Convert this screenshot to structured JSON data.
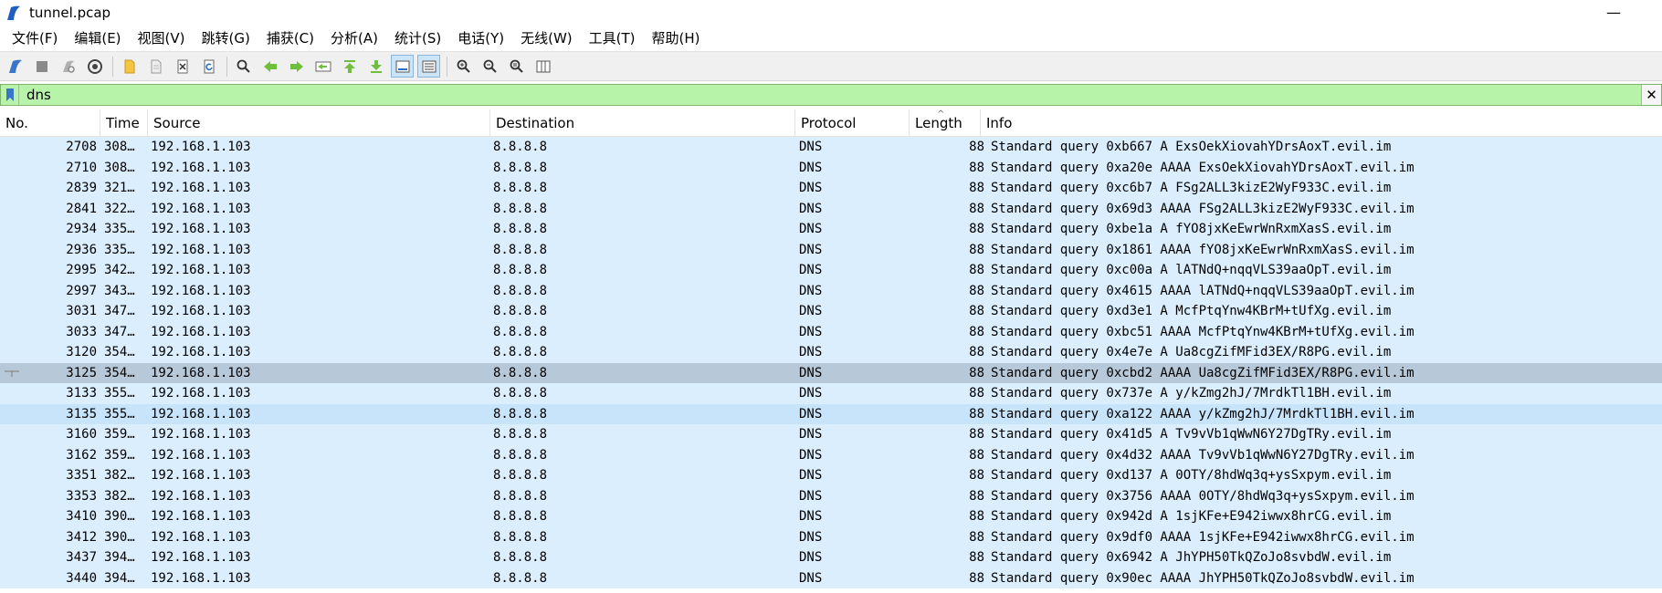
{
  "window": {
    "title": "tunnel.pcap",
    "minimize": "—"
  },
  "menu": [
    "文件(F)",
    "编辑(E)",
    "视图(V)",
    "跳转(G)",
    "捕获(C)",
    "分析(A)",
    "统计(S)",
    "电话(Y)",
    "无线(W)",
    "工具(T)",
    "帮助(H)"
  ],
  "filter": {
    "value": "dns",
    "clear": "✕"
  },
  "columns": {
    "no": "No.",
    "time": "Time",
    "source": "Source",
    "destination": "Destination",
    "protocol": "Protocol",
    "length": "Length",
    "info": "Info",
    "sort_indicator": "^"
  },
  "colors": {
    "row_bg": "#daeefe",
    "selected_bg": "#b7c8d8",
    "filter_bg": "#b7f3a8"
  },
  "packets": [
    {
      "no": "2708",
      "time": "308…",
      "src": "192.168.1.103",
      "dst": "8.8.8.8",
      "proto": "DNS",
      "len": "88",
      "info": "Standard query 0xb667 A ExsOekXiovahYDrsAoxT.evil.im"
    },
    {
      "no": "2710",
      "time": "308…",
      "src": "192.168.1.103",
      "dst": "8.8.8.8",
      "proto": "DNS",
      "len": "88",
      "info": "Standard query 0xa20e AAAA ExsOekXiovahYDrsAoxT.evil.im"
    },
    {
      "no": "2839",
      "time": "321…",
      "src": "192.168.1.103",
      "dst": "8.8.8.8",
      "proto": "DNS",
      "len": "88",
      "info": "Standard query 0xc6b7 A FSg2ALL3kizE2WyF933C.evil.im"
    },
    {
      "no": "2841",
      "time": "322…",
      "src": "192.168.1.103",
      "dst": "8.8.8.8",
      "proto": "DNS",
      "len": "88",
      "info": "Standard query 0x69d3 AAAA FSg2ALL3kizE2WyF933C.evil.im"
    },
    {
      "no": "2934",
      "time": "335…",
      "src": "192.168.1.103",
      "dst": "8.8.8.8",
      "proto": "DNS",
      "len": "88",
      "info": "Standard query 0xbe1a A fYO8jxKeEwrWnRxmXasS.evil.im"
    },
    {
      "no": "2936",
      "time": "335…",
      "src": "192.168.1.103",
      "dst": "8.8.8.8",
      "proto": "DNS",
      "len": "88",
      "info": "Standard query 0x1861 AAAA fYO8jxKeEwrWnRxmXasS.evil.im"
    },
    {
      "no": "2995",
      "time": "342…",
      "src": "192.168.1.103",
      "dst": "8.8.8.8",
      "proto": "DNS",
      "len": "88",
      "info": "Standard query 0xc00a A lATNdQ+nqqVLS39aaOpT.evil.im"
    },
    {
      "no": "2997",
      "time": "343…",
      "src": "192.168.1.103",
      "dst": "8.8.8.8",
      "proto": "DNS",
      "len": "88",
      "info": "Standard query 0x4615 AAAA lATNdQ+nqqVLS39aaOpT.evil.im"
    },
    {
      "no": "3031",
      "time": "347…",
      "src": "192.168.1.103",
      "dst": "8.8.8.8",
      "proto": "DNS",
      "len": "88",
      "info": "Standard query 0xd3e1 A McfPtqYnw4KBrM+tUfXg.evil.im"
    },
    {
      "no": "3033",
      "time": "347…",
      "src": "192.168.1.103",
      "dst": "8.8.8.8",
      "proto": "DNS",
      "len": "88",
      "info": "Standard query 0xbc51 AAAA McfPtqYnw4KBrM+tUfXg.evil.im"
    },
    {
      "no": "3120",
      "time": "354…",
      "src": "192.168.1.103",
      "dst": "8.8.8.8",
      "proto": "DNS",
      "len": "88",
      "info": "Standard query 0x4e7e A Ua8cgZifMFid3EX/R8PG.evil.im"
    },
    {
      "no": "3125",
      "time": "354…",
      "src": "192.168.1.103",
      "dst": "8.8.8.8",
      "proto": "DNS",
      "len": "88",
      "info": "Standard query 0xcbd2 AAAA Ua8cgZifMFid3EX/R8PG.evil.im"
    },
    {
      "no": "3133",
      "time": "355…",
      "src": "192.168.1.103",
      "dst": "8.8.8.8",
      "proto": "DNS",
      "len": "88",
      "info": "Standard query 0x737e A y/kZmg2hJ/7MrdkTl1BH.evil.im"
    },
    {
      "no": "3135",
      "time": "355…",
      "src": "192.168.1.103",
      "dst": "8.8.8.8",
      "proto": "DNS",
      "len": "88",
      "info": "Standard query 0xa122 AAAA y/kZmg2hJ/7MrdkTl1BH.evil.im"
    },
    {
      "no": "3160",
      "time": "359…",
      "src": "192.168.1.103",
      "dst": "8.8.8.8",
      "proto": "DNS",
      "len": "88",
      "info": "Standard query 0x41d5 A Tv9vVb1qWwN6Y27DgTRy.evil.im"
    },
    {
      "no": "3162",
      "time": "359…",
      "src": "192.168.1.103",
      "dst": "8.8.8.8",
      "proto": "DNS",
      "len": "88",
      "info": "Standard query 0x4d32 AAAA Tv9vVb1qWwN6Y27DgTRy.evil.im"
    },
    {
      "no": "3351",
      "time": "382…",
      "src": "192.168.1.103",
      "dst": "8.8.8.8",
      "proto": "DNS",
      "len": "88",
      "info": "Standard query 0xd137 A 0OTY/8hdWq3q+ysSxpym.evil.im"
    },
    {
      "no": "3353",
      "time": "382…",
      "src": "192.168.1.103",
      "dst": "8.8.8.8",
      "proto": "DNS",
      "len": "88",
      "info": "Standard query 0x3756 AAAA 0OTY/8hdWq3q+ysSxpym.evil.im"
    },
    {
      "no": "3410",
      "time": "390…",
      "src": "192.168.1.103",
      "dst": "8.8.8.8",
      "proto": "DNS",
      "len": "88",
      "info": "Standard query 0x942d A 1sjKFe+E942iwwx8hrCG.evil.im"
    },
    {
      "no": "3412",
      "time": "390…",
      "src": "192.168.1.103",
      "dst": "8.8.8.8",
      "proto": "DNS",
      "len": "88",
      "info": "Standard query 0x9df0 AAAA 1sjKFe+E942iwwx8hrCG.evil.im"
    },
    {
      "no": "3437",
      "time": "394…",
      "src": "192.168.1.103",
      "dst": "8.8.8.8",
      "proto": "DNS",
      "len": "88",
      "info": "Standard query 0x6942 A JhYPH50TkQZoJo8svbdW.evil.im"
    },
    {
      "no": "3440",
      "time": "394…",
      "src": "192.168.1.103",
      "dst": "8.8.8.8",
      "proto": "DNS",
      "len": "88",
      "info": "Standard query 0x90ec AAAA JhYPH50TkQZoJo8svbdW.evil.im"
    }
  ]
}
